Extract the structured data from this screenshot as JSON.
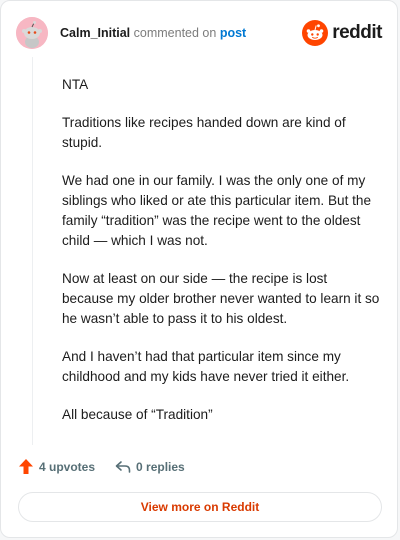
{
  "header": {
    "username": "Calm_Initial",
    "commented_text": "commented on",
    "post_link": "post",
    "logo_text": "reddit",
    "avatar_icon": "snoo-avatar-icon",
    "logo_icon": "reddit-alien-icon"
  },
  "comment": {
    "paragraphs": [
      "NTA",
      "Traditions like recipes handed down are kind of stupid.",
      "We had one in our family. I was the only one of my siblings who liked or ate this particular item. But the family “tradition” was the recipe went to the oldest child — which I was not.",
      "Now at least on our side — the recipe is lost because my older brother never wanted to learn it so he wasn’t able to pass it to his oldest.",
      "And I haven’t had that particular item since my childhood and my kids have never tried it either.",
      "All because of “Tradition”"
    ]
  },
  "actions": {
    "upvotes_label": "4 upvotes",
    "replies_label": "0 replies",
    "upvote_icon": "upvote-arrow-icon",
    "reply_icon": "reply-arrow-icon"
  },
  "view_more": {
    "label": "View more on Reddit"
  },
  "colors": {
    "brand": "#ff4500",
    "link": "#0079d3",
    "view_more_text": "#d93a00",
    "avatar_bg": "#f7b7c3"
  }
}
